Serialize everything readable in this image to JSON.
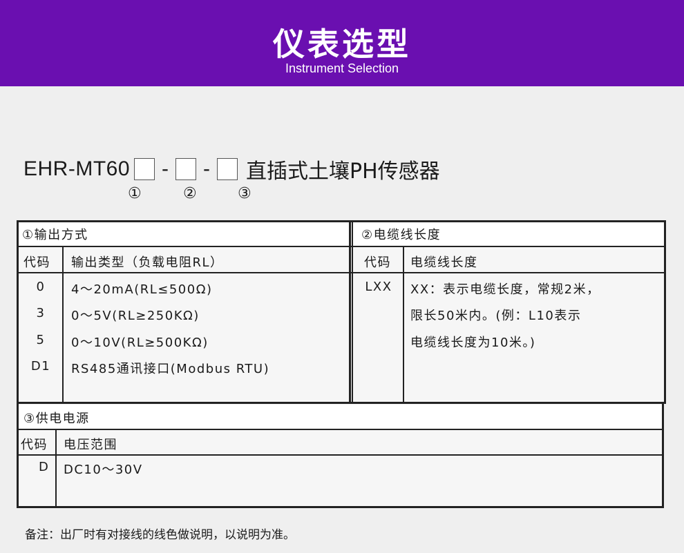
{
  "banner": {
    "title": "仪表选型",
    "subtitle": "Instrument Selection",
    "color": "#6a0fb0"
  },
  "model": {
    "prefix": "EHR-MT60",
    "dash": "-",
    "name": "直插式土壤PH传感器",
    "markers": [
      "①",
      "②",
      "③"
    ]
  },
  "section1": {
    "title": "①输出方式",
    "col_code": "代码",
    "col_desc": "输出类型（负载电阻RL）",
    "rows": [
      {
        "code": "0",
        "desc": "4～20mA(RL≤500Ω)"
      },
      {
        "code": "3",
        "desc": "0～5V(RL≥250KΩ)"
      },
      {
        "code": "5",
        "desc": "0～10V(RL≥500KΩ)"
      },
      {
        "code": "D1",
        "desc": "RS485通讯接口(Modbus RTU)"
      }
    ]
  },
  "section2": {
    "title": "②电缆线长度",
    "col_code": "代码",
    "col_desc": "电缆线长度",
    "code": "LXX",
    "desc_lines": [
      "XX：表示电缆长度，常规2米，",
      "限长50米内。(例：L10表示",
      "电缆线长度为10米。)"
    ]
  },
  "section3": {
    "title": "③供电电源",
    "col_code": "代码",
    "col_desc": "电压范围",
    "rows": [
      {
        "code": "D",
        "desc": "DC10～30V"
      }
    ]
  },
  "footnote": "备注：出厂时有对接线的线色做说明，以说明为准。"
}
